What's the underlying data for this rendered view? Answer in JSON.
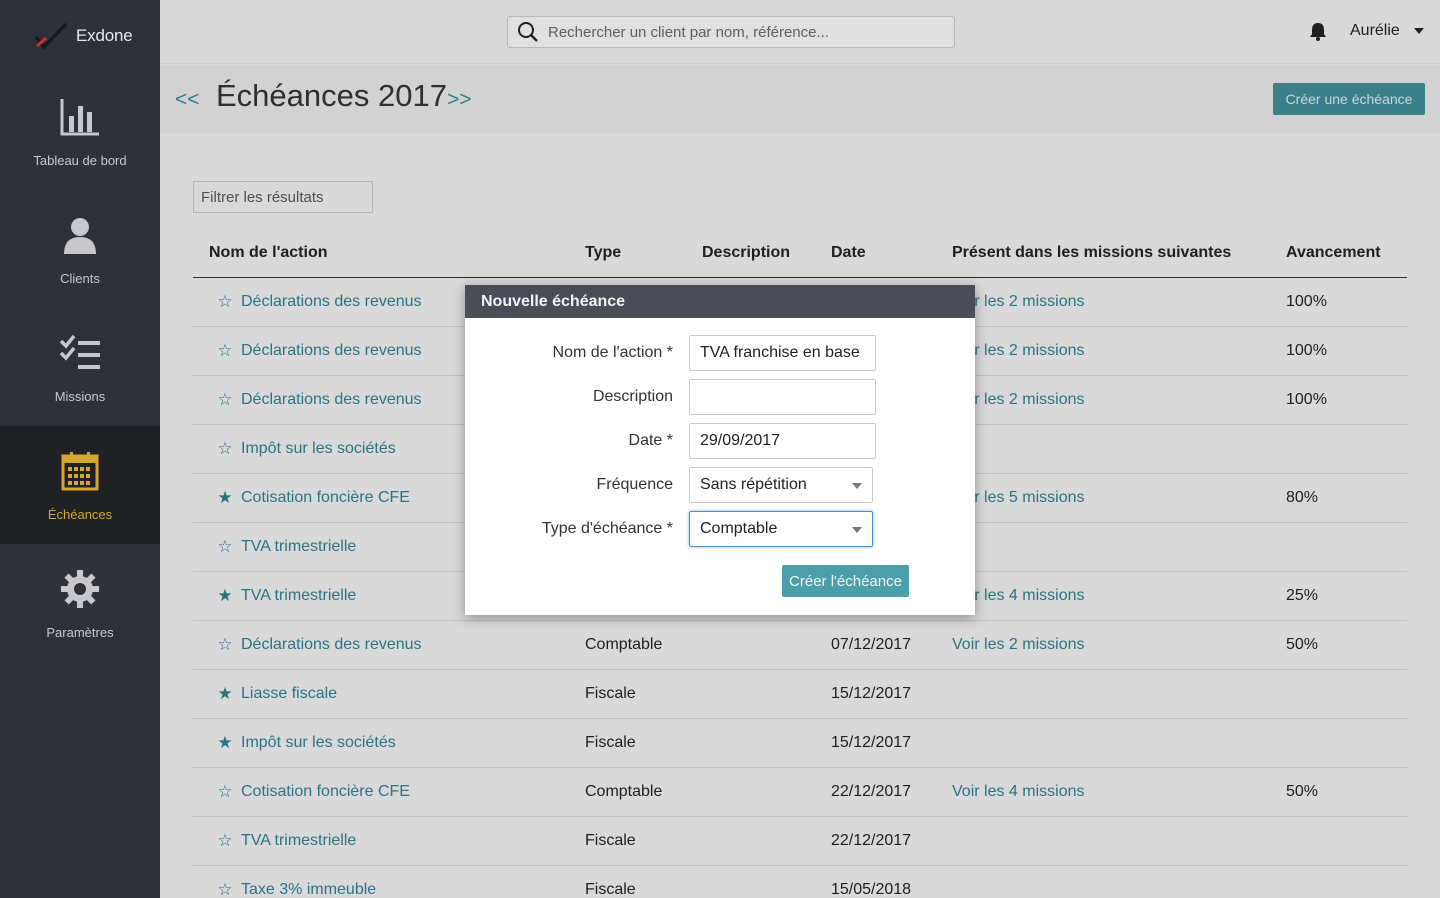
{
  "app": {
    "name": "Exdone"
  },
  "sidebar": {
    "items": [
      {
        "label": "Tableau de bord",
        "icon": "bar-chart-icon"
      },
      {
        "label": "Clients",
        "icon": "user-icon"
      },
      {
        "label": "Missions",
        "icon": "checklist-icon"
      },
      {
        "label": "Échéances",
        "icon": "calendar-icon",
        "active": true
      },
      {
        "label": "Paramètres",
        "icon": "gear-icon"
      }
    ]
  },
  "topbar": {
    "search_placeholder": "Rechercher un client par nom, référence...",
    "user_name": "Aurélie"
  },
  "header": {
    "prev": "<<",
    "title": "Échéances 2017",
    "next": ">>",
    "create_button": "Créer une échéance"
  },
  "filter": {
    "placeholder": "Filtrer les résultats"
  },
  "table": {
    "columns": [
      "Nom de l'action",
      "Type",
      "Description",
      "Date",
      "Présent dans les missions suivantes",
      "Avancement"
    ],
    "rows": [
      {
        "star": "☆",
        "name": "Déclarations des revenus",
        "type": "",
        "date": "",
        "missions": "Voir les 2 missions",
        "progress": "100%"
      },
      {
        "star": "☆",
        "name": "Déclarations des revenus",
        "type": "",
        "date": "",
        "missions": "Voir les 2 missions",
        "progress": "100%"
      },
      {
        "star": "☆",
        "name": "Déclarations des revenus",
        "type": "",
        "date": "",
        "missions": "Voir les 2 missions",
        "progress": "100%"
      },
      {
        "star": "☆",
        "name": "Impôt sur les sociétés",
        "type": "",
        "date": "",
        "missions": "",
        "progress": ""
      },
      {
        "star": "★",
        "name": "Cotisation foncière CFE",
        "type": "",
        "date": "",
        "missions": "Voir les 5 missions",
        "progress": "80%"
      },
      {
        "star": "☆",
        "name": "TVA trimestrielle",
        "type": "",
        "date": "",
        "missions": "",
        "progress": ""
      },
      {
        "star": "★",
        "name": "TVA trimestrielle",
        "type": "",
        "date": "",
        "missions": "Voir les 4 missions",
        "progress": "25%"
      },
      {
        "star": "☆",
        "name": "Déclarations des revenus",
        "type": "Comptable",
        "date": "07/12/2017",
        "missions": "Voir les 2 missions",
        "progress": "50%"
      },
      {
        "star": "★",
        "name": "Liasse fiscale",
        "type": "Fiscale",
        "date": "15/12/2017",
        "missions": "",
        "progress": ""
      },
      {
        "star": "★",
        "name": "Impôt sur les sociétés",
        "type": "Fiscale",
        "date": "15/12/2017",
        "missions": "",
        "progress": ""
      },
      {
        "star": "☆",
        "name": "Cotisation foncière CFE",
        "type": "Comptable",
        "date": "22/12/2017",
        "missions": "Voir les 4 missions",
        "progress": "50%"
      },
      {
        "star": "☆",
        "name": "TVA trimestrielle",
        "type": "Fiscale",
        "date": "22/12/2017",
        "missions": "",
        "progress": ""
      },
      {
        "star": "☆",
        "name": "Taxe 3% immeuble",
        "type": "Fiscale",
        "date": "15/05/2018",
        "missions": "",
        "progress": ""
      }
    ]
  },
  "modal": {
    "title": "Nouvelle échéance",
    "fields": {
      "name_label": "Nom de l'action *",
      "name_value": "TVA franchise en base",
      "description_label": "Description",
      "description_value": "",
      "date_label": "Date *",
      "date_value": "29/09/2017",
      "frequency_label": "Fréquence",
      "frequency_value": "Sans répétition",
      "type_label": "Type d'échéance *",
      "type_value": "Comptable"
    },
    "submit": "Créer l'échéance"
  }
}
